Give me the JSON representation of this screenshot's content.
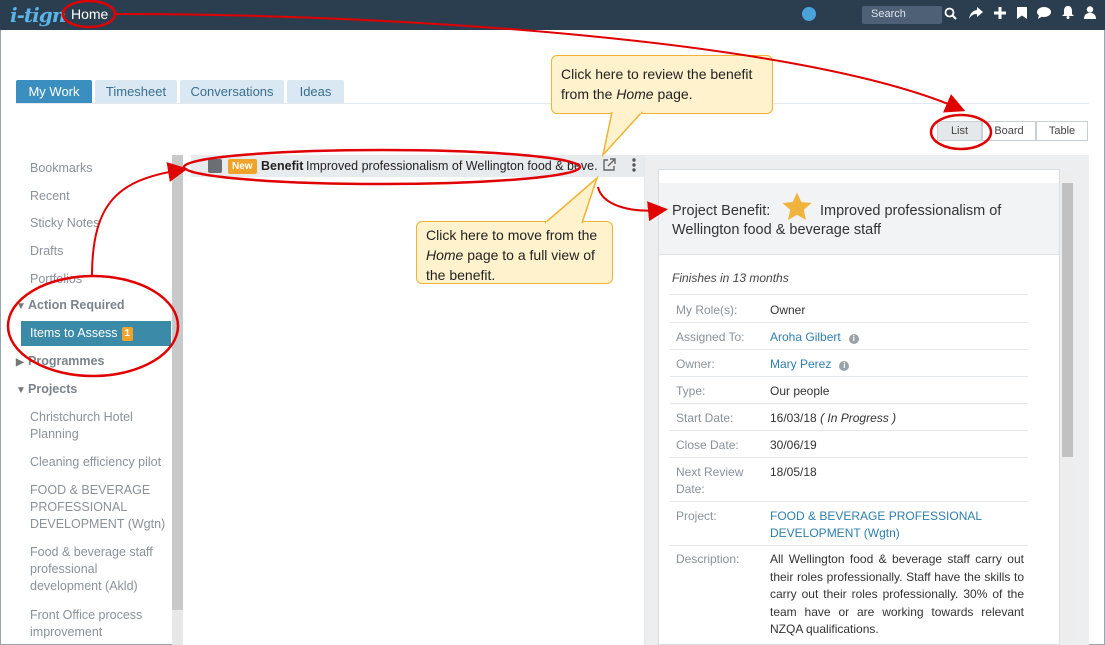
{
  "app": {
    "logo": "i-tign",
    "title": "Home"
  },
  "topbar": {
    "search_placeholder": "Search",
    "icons": [
      "globe-icon",
      "search-icon",
      "share-icon",
      "add-icon",
      "bookmark-icon",
      "chat-icon",
      "bell-icon",
      "user-icon"
    ]
  },
  "tabs": [
    {
      "label": "My Work",
      "active": true
    },
    {
      "label": "Timesheet"
    },
    {
      "label": "Conversations"
    },
    {
      "label": "Ideas"
    }
  ],
  "view": {
    "list": "List",
    "board": "Board",
    "table": "Table",
    "selected": "List"
  },
  "sidebar": {
    "items": [
      "Bookmarks",
      "Recent",
      "Sticky Notes",
      "Drafts",
      "Portfolios"
    ],
    "action_required": "Action Required",
    "items_to_assess": "Items to Assess",
    "items_to_assess_count": "1",
    "programmes": "Programmes",
    "projects": "Projects",
    "project_items": [
      "Christchurch Hotel Planning",
      "Cleaning efficiency pilot",
      "FOOD & BEVERAGE PROFESSIONAL DEVELOPMENT (Wgtn)",
      "Food & beverage staff professional development (Akld)",
      "Front Office process improvement"
    ]
  },
  "list_item": {
    "badge": "New",
    "type": "Benefit",
    "title": "Improved professionalism of Wellington food & beve..."
  },
  "detail": {
    "prefix": "Project Benefit:",
    "title_line1": "Improved professionalism of",
    "title_line2": "Wellington food & beverage staff",
    "finishes": "Finishes in 13 months",
    "fields": {
      "my_role": {
        "label": "My Role(s):",
        "value": "Owner"
      },
      "assigned_to": {
        "label": "Assigned To:",
        "value": "Aroha Gilbert"
      },
      "owner": {
        "label": "Owner:",
        "value": "Mary Perez"
      },
      "type": {
        "label": "Type:",
        "value": "Our people"
      },
      "start_date": {
        "label": "Start Date:",
        "value": "16/03/18",
        "status": "( In Progress )"
      },
      "close_date": {
        "label": "Close Date:",
        "value": "30/06/19"
      },
      "next_review": {
        "label_line1": "Next Review",
        "label_line2": "Date:",
        "value": "18/05/18"
      },
      "project": {
        "label": "Project:",
        "value_line1": "FOOD & BEVERAGE PROFESSIONAL",
        "value_line2": "DEVELOPMENT (Wgtn)"
      },
      "description": {
        "label": "Description:",
        "value": "All Wellington food & beverage staff carry out their roles professionally. Staff have the skills to carry out their roles professionally. 30% of the team have or are working towards relevant NZQA qualifications."
      }
    }
  },
  "callouts": {
    "review": {
      "before": "Click here to review the benefit from the ",
      "em": "Home",
      "after": " page."
    },
    "full_view": {
      "before": "Click here to move from the ",
      "em": "Home",
      "after": " page to a full view of the benefit."
    }
  },
  "colors": {
    "topbar": "#2b3e50",
    "accent": "#3b8fc0",
    "annotation": "#e00000",
    "callout_bg": "#fff2cc",
    "badge": "#f0a32a"
  }
}
